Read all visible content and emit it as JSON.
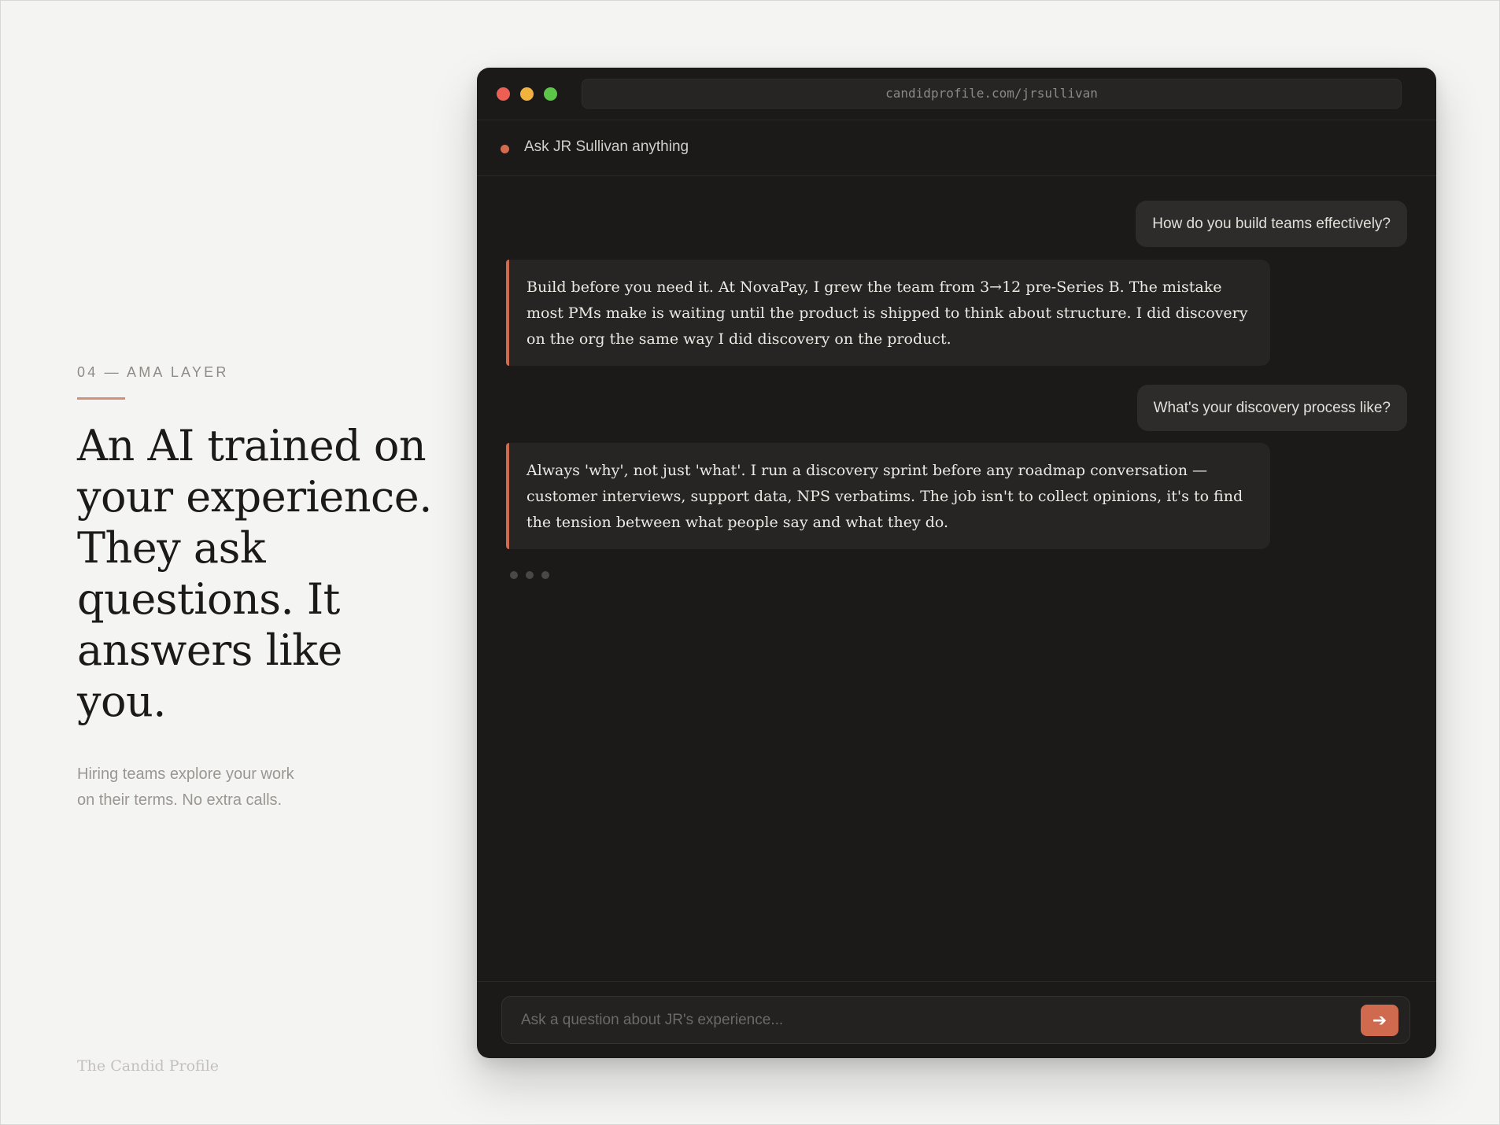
{
  "left": {
    "eyebrow": "04 — AMA LAYER",
    "headline_lines": [
      "An AI trained on",
      "your experience.",
      "They ask",
      "questions. It",
      "answers like you."
    ],
    "subcopy_lines": [
      "Hiring teams explore your work",
      "on their terms. No extra calls."
    ],
    "footer_brand": "The Candid Profile"
  },
  "browser": {
    "url": "candidprofile.com/jrsullivan",
    "chat_title": "Ask JR Sullivan anything",
    "messages": [
      {
        "role": "user",
        "text": "How do you build teams effectively?"
      },
      {
        "role": "ai",
        "text": "Build before you need it. At NovaPay, I grew the team from 3→12 pre-Series B. The mistake most PMs make is waiting until the product is shipped to think about structure. I did discovery on the org the same way I did discovery on the product."
      },
      {
        "role": "user",
        "text": "What's your discovery process like?"
      },
      {
        "role": "ai",
        "text": "Always 'why', not just 'what'. I run a discovery sprint before any roadmap conversation — customer interviews, support data, NPS verbatims. The job isn't to collect opinions, it's to find the tension between what people say and what they do."
      }
    ],
    "composer": {
      "placeholder": "Ask a question about JR's experience...",
      "send_icon": "arrow-right-icon",
      "send_glyph": "➔"
    }
  },
  "colors": {
    "accent": "#cf6a4f",
    "window_bg": "#1b1a19",
    "page_bg": "#f4f4f2"
  }
}
